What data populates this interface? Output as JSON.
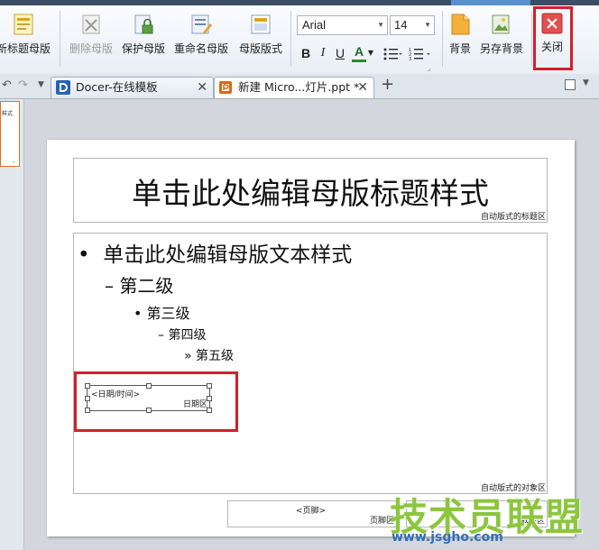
{
  "ribbon": {
    "buttons": {
      "new_title_master": "新标题母版",
      "delete_master": "删除母版",
      "protect_master": "保护母版",
      "rename_master": "重命名母版",
      "master_layout": "母版版式",
      "background": "背景",
      "save_background": "另存背景",
      "close": "关闭"
    },
    "font": {
      "name": "Arial",
      "size": "14"
    },
    "format": {
      "bold": "B",
      "italic": "I",
      "underline": "U",
      "font_color": "A"
    }
  },
  "tabs": [
    {
      "label": "Docer-在线模板"
    },
    {
      "label": "新建 Micro...灯片.ppt *"
    }
  ],
  "slide": {
    "title_text": "单击此处编辑母版标题样式",
    "title_area_label": "自动版式的标题区",
    "body_levels": [
      {
        "bullet": "•",
        "text": "单击此处编辑母版文本样式"
      },
      {
        "bullet": "–",
        "text": "第二级"
      },
      {
        "bullet": "•",
        "text": "第三级"
      },
      {
        "bullet": "–",
        "text": "第四级"
      },
      {
        "bullet": "»",
        "text": "第五级"
      }
    ],
    "object_area_label": "自动版式的对象区",
    "date_placeholder": "<日期/时间>",
    "date_area_label": "日期区",
    "footer_placeholder": "<页脚>",
    "footer_area_label": "页脚区",
    "number_area_label": "数字区"
  },
  "thumbnail_text": "样式",
  "watermark": {
    "text": "技术员联盟",
    "url": "www.jsgho.com"
  },
  "colors": {
    "highlight": "#d0202a",
    "close_icon": "#e05050",
    "watermark_green": "#8cc63f",
    "watermark_blue": "#2f6fb8"
  }
}
